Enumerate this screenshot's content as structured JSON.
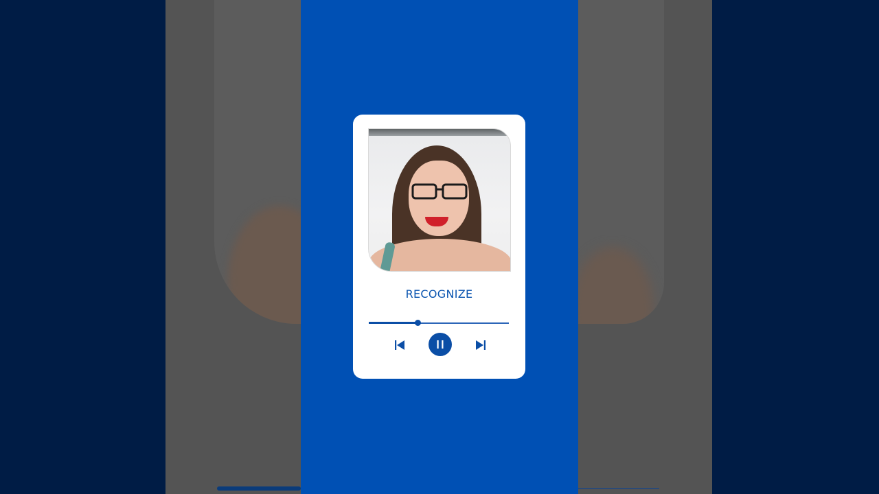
{
  "player": {
    "track_title": "RECOGNIZE",
    "progress": 0.35,
    "state": "playing",
    "controls": {
      "previous_icon": "skip-previous-icon",
      "pause_icon": "pause-icon",
      "next_icon": "skip-next-icon"
    },
    "colors": {
      "accent": "#0b4ea6",
      "panel": "#0050b4",
      "outer_background": "#001c45"
    }
  }
}
